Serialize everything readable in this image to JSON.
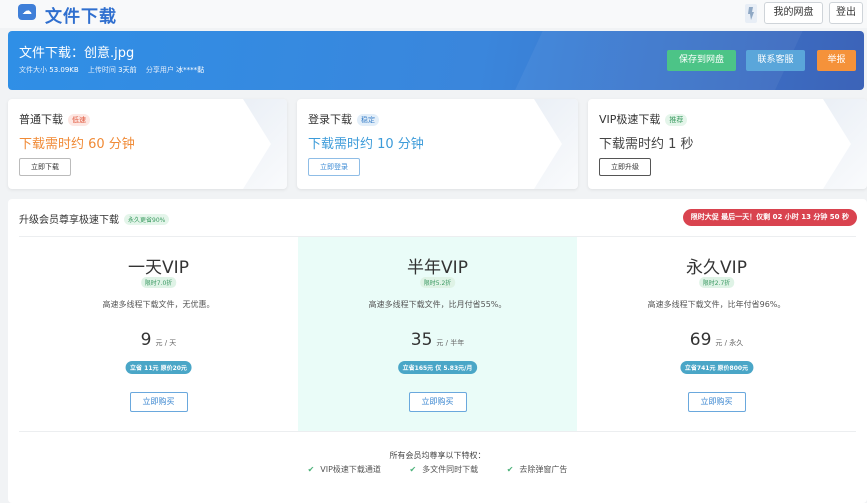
{
  "header": {
    "site_title": "文件下载",
    "my_disk": "我的网盘",
    "logout": "登出"
  },
  "banner": {
    "file_title": "文件下载：创意.jpg",
    "size_label": "文件大小",
    "size_value": "53.09KB",
    "upload_label": "上传时间",
    "upload_value": "3天前",
    "sharer_label": "分享用户",
    "sharer_value": "冰****黏",
    "save_btn": "保存到网盘",
    "contact_btn": "联系客服",
    "report_btn": "举报"
  },
  "cards": [
    {
      "name": "普通下载",
      "tag": "低速",
      "time": "下载需时约 60 分钟",
      "button": "立即下载"
    },
    {
      "name": "登录下载",
      "tag": "稳定",
      "time": "下载需时约 10 分钟",
      "button": "立即登录"
    },
    {
      "name": "VIP极速下载",
      "tag": "推荐",
      "time": "下载需时约 1 秒",
      "button": "立即升级"
    }
  ],
  "upgrade": {
    "title": "升级会员尊享极速下载",
    "tag": "永久更省90%",
    "countdown": "限时大促 最后一天！仅剩 02 小时 13 分钟 50 秒",
    "plans": [
      {
        "name": "一天VIP",
        "discount": "限时7.0折",
        "desc": "高速多线程下载文件，无优惠。",
        "price": "9",
        "unit": "元 / 天",
        "save": "立省 11元 原价20元",
        "button": "立即购买"
      },
      {
        "name": "半年VIP",
        "discount": "限时5.2折",
        "desc": "高速多线程下载文件，比月付省55%。",
        "price": "35",
        "unit": "元 / 半年",
        "save": "立省165元 仅 5.83元/月",
        "button": "立即购买"
      },
      {
        "name": "永久VIP",
        "discount": "限时2.7折",
        "desc": "高速多线程下载文件，比年付省96%。",
        "price": "69",
        "unit": "元 / 永久",
        "save": "立省741元 原价800元",
        "button": "立即购买"
      }
    ],
    "privileges_title": "所有会员均尊享以下特权：",
    "privileges": [
      "VIP极速下载通道",
      "多文件同时下载",
      "去除弹窗广告"
    ]
  },
  "colors": {
    "brand": "#2f6fcf",
    "save_green": "#4cc487",
    "contact_blue": "#5aa6da",
    "report_orange": "#f5923a",
    "countdown_red": "#d9434f"
  }
}
